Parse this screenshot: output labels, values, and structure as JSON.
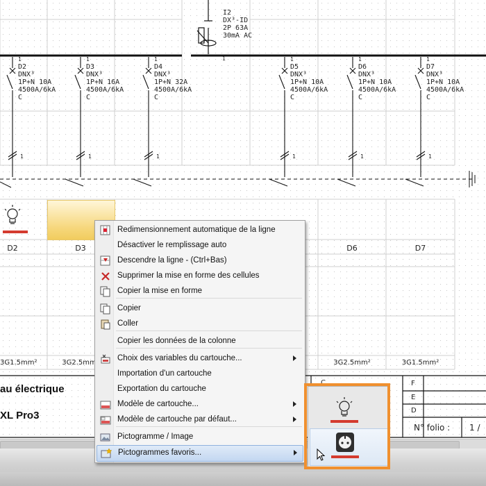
{
  "schematic": {
    "main_breaker": {
      "ref": "I2",
      "model": "DX³-ID",
      "spec": "2P 63A",
      "sensitivity": "30mA AC",
      "terminal": "1"
    },
    "circuits": [
      {
        "num": "1",
        "ref": "D2",
        "model": "DNX³",
        "poles": "1P+N 10A",
        "capacity": "4500A/6kA",
        "curve": "C"
      },
      {
        "num": "1",
        "ref": "D3",
        "model": "DNX³",
        "poles": "1P+N 16A",
        "capacity": "4500A/6kA",
        "curve": "C"
      },
      {
        "num": "1",
        "ref": "D4",
        "model": "DNX³",
        "poles": "1P+N 32A",
        "capacity": "4500A/6kA",
        "curve": "C"
      },
      {
        "num": "1",
        "ref": "D5",
        "model": "DNX³",
        "poles": "1P+N 10A",
        "capacity": "4500A/6kA",
        "curve": "C"
      },
      {
        "num": "1",
        "ref": "D6",
        "model": "DNX³",
        "poles": "1P+N 10A",
        "capacity": "4500A/6kA",
        "curve": "C"
      },
      {
        "num": "1",
        "ref": "D7",
        "model": "DNX³",
        "poles": "1P+N 10A",
        "capacity": "4500A/6kA",
        "curve": "C"
      }
    ],
    "wire_marks": [
      "1",
      "1",
      "1",
      "1",
      "1",
      "1"
    ],
    "cell_labels": [
      "D2",
      "D3",
      "D6",
      "D7"
    ],
    "cable_labels": [
      "3G1.5mm²",
      "3G2.5mm²",
      "3G2.5mm²",
      "3G1.5mm²"
    ]
  },
  "title_block": {
    "title_partial": "au électrique",
    "subtitle_partial": "XL Pro3",
    "letters_left": [
      "C"
    ],
    "letters_right": [
      "F",
      "E",
      "D"
    ],
    "folio_label": "N° folio :",
    "folio_value": "1 /"
  },
  "context_menu": {
    "items": [
      {
        "label": "Redimensionnement automatique de la ligne",
        "icon": "resize-grid-icon"
      },
      {
        "label": "Désactiver le remplissage auto",
        "icon": ""
      },
      {
        "label": "Descendre la ligne - (Ctrl+Bas)",
        "icon": "move-row-down-icon"
      },
      {
        "label": "Supprimer la mise en forme des cellules",
        "icon": "delete-x-icon"
      },
      {
        "label": "Copier la mise en forme",
        "icon": "copy-format-icon"
      },
      {
        "label": "Copier",
        "icon": "copy-icon"
      },
      {
        "label": "Coller",
        "icon": "paste-icon"
      },
      {
        "label": "Copier les données de la colonne",
        "icon": ""
      },
      {
        "label": "Choix des variables du cartouche...",
        "icon": "variables-icon",
        "submenu": true
      },
      {
        "label": "Importation d'un cartouche",
        "icon": ""
      },
      {
        "label": "Exportation du cartouche",
        "icon": ""
      },
      {
        "label": "Modèle de cartouche...",
        "icon": "title-block-template-icon",
        "submenu": true
      },
      {
        "label": "Modèle de cartouche par défaut...",
        "icon": "default-template-icon",
        "submenu": true
      },
      {
        "label": "Pictogramme / Image",
        "icon": "picture-icon"
      },
      {
        "label": "Pictogrammes favoris...",
        "icon": "favorite-pictures-icon",
        "submenu": true,
        "highlighted": true
      }
    ]
  },
  "submenu": {
    "items": [
      {
        "icon": "light-bulb-icon",
        "selected": false
      },
      {
        "icon": "power-outlet-icon",
        "selected": true
      }
    ],
    "accent_color": "#f0902f"
  }
}
